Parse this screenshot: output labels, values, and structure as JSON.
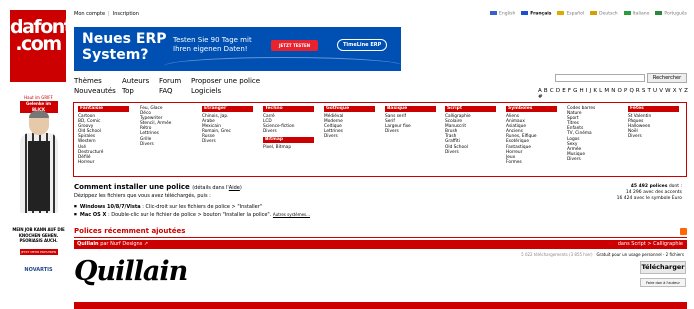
{
  "logo": {
    "line1": "dafont",
    "line2": ".com"
  },
  "toplinks": {
    "account": "Mon compte",
    "signup": "Inscription"
  },
  "languages": [
    {
      "label": "English",
      "flag": "#3a5fcd"
    },
    {
      "label": "Français",
      "flag": "#1f4fd1"
    },
    {
      "label": "Español",
      "flag": "#e0a800"
    },
    {
      "label": "Deutsch",
      "flag": "#d4a000"
    },
    {
      "label": "Italiano",
      "flag": "#2a9d3a"
    },
    {
      "label": "Português",
      "flag": "#2a8a3a"
    }
  ],
  "banner": {
    "title": "Neues ERP System?",
    "text": "Testen Sie 90 Tage mit Ihren eigenen Daten!",
    "cta": "JETZT TESTEN",
    "brand": "TimeLine ERP"
  },
  "side_ad": {
    "badge": "Haut im GRIFF",
    "badge2": "Gelenke im BLICK",
    "caption": "MEIN JOB KANN AUF DIE KNOCHEN GEHEN. PSORIASIS AUCH.",
    "button": "JETZT MEHR ERFAHREN",
    "brand": "NOVARTIS"
  },
  "nav": {
    "row1": [
      "Thèmes",
      "Auteurs",
      "Forum",
      "Proposer une police"
    ],
    "row2": [
      "Nouveautés",
      "Top",
      "FAQ",
      "Logiciels"
    ]
  },
  "search": {
    "button": "Rechercher",
    "placeholder": ""
  },
  "alphabet": "A B C D E F G H I J K L M N O P Q R S T U V W X Y Z #",
  "categories": [
    {
      "title": "Fantaisie",
      "items": [
        "Cartoon",
        "BD, Comic",
        "Groovy",
        "Old School",
        "Spirales",
        "Western",
        "Usé",
        "Destructuré",
        "Défilé",
        "Horreur"
      ]
    },
    {
      "title": "",
      "items": [
        "Feu, Glace",
        "Déco",
        "Typewriter",
        "Stencil, Armée",
        "Rétro",
        "Lettrines",
        "Grille",
        "Divers"
      ]
    },
    {
      "title": "Etranger",
      "items": [
        "Chinois, Jap.",
        "Arabe",
        "Mexicain",
        "Romain, Grec",
        "Russe",
        "Divers"
      ]
    },
    {
      "title": "Techno",
      "items": [
        "Carré",
        "LCD",
        "Science-fiction",
        "Divers"
      ],
      "sub_title": "Bitmap",
      "sub_items": [
        "Pixel, Bitmap"
      ]
    },
    {
      "title": "Gothique",
      "items": [
        "Médiéval",
        "Moderne",
        "Celtique",
        "Lettrines",
        "Divers"
      ]
    },
    {
      "title": "Basique",
      "items": [
        "Sans serif",
        "Serif",
        "Largeur fixe",
        "Divers"
      ]
    },
    {
      "title": "Script",
      "items": [
        "Calligraphie",
        "Scolaire",
        "Manuscrit",
        "Brush",
        "Trash",
        "Graffiti",
        "Old School",
        "Divers"
      ]
    },
    {
      "title": "Symboles",
      "items": [
        "Aliens",
        "Animaux",
        "Asiatique",
        "Anciens",
        "Runes, Elfique",
        "Esotérique",
        "Fantastique",
        "Horreur",
        "Jeux",
        "Formes"
      ]
    },
    {
      "title": "",
      "items": [
        "Codes barres",
        "Nature",
        "Sport",
        "Titres",
        "Enfants",
        "TV, Cinéma",
        "Logos",
        "Sexy",
        "Armée",
        "Musique",
        "Divers"
      ]
    },
    {
      "title": "Fêtes",
      "items": [
        "St Valentin",
        "Pâques",
        "Halloween",
        "Noël",
        "Divers"
      ]
    }
  ],
  "howto": {
    "title": "Comment installer une police",
    "details": "(détails dans l'",
    "aide": "Aide",
    "close": ")",
    "subtitle": "Dézippez les fichiers que vous avez téléchargés, puis :",
    "windows_label": "Windows 10/8/7/Vista",
    "windows_text": " : Clic-droit sur les fichiers de police > \"Installer\"",
    "mac_label": "Mac OS X",
    "mac_text": " : Double-clic sur le fichier de police > bouton \"Installer la police\".",
    "other": "Autres systèmes..."
  },
  "stats": {
    "line1_count": "45 492 polices",
    "line1_suffix": " dont :",
    "line2": "14 296 avec des accents",
    "line3": "16 424 avec le symbole Euro"
  },
  "recent": {
    "title": "Polices récemment ajoutées"
  },
  "font": {
    "name": "Quillain",
    "by": " par Nurf Designs",
    "category": "dans Script > Calligraphie",
    "downloads": "5 022 téléchargements (3 855 hier)",
    "license": "Gratuit pour un usage personnel - 2 fichiers",
    "download_button": "Télécharger",
    "donate_button": "Faire don à l'auteur",
    "sample": "Quillain"
  }
}
